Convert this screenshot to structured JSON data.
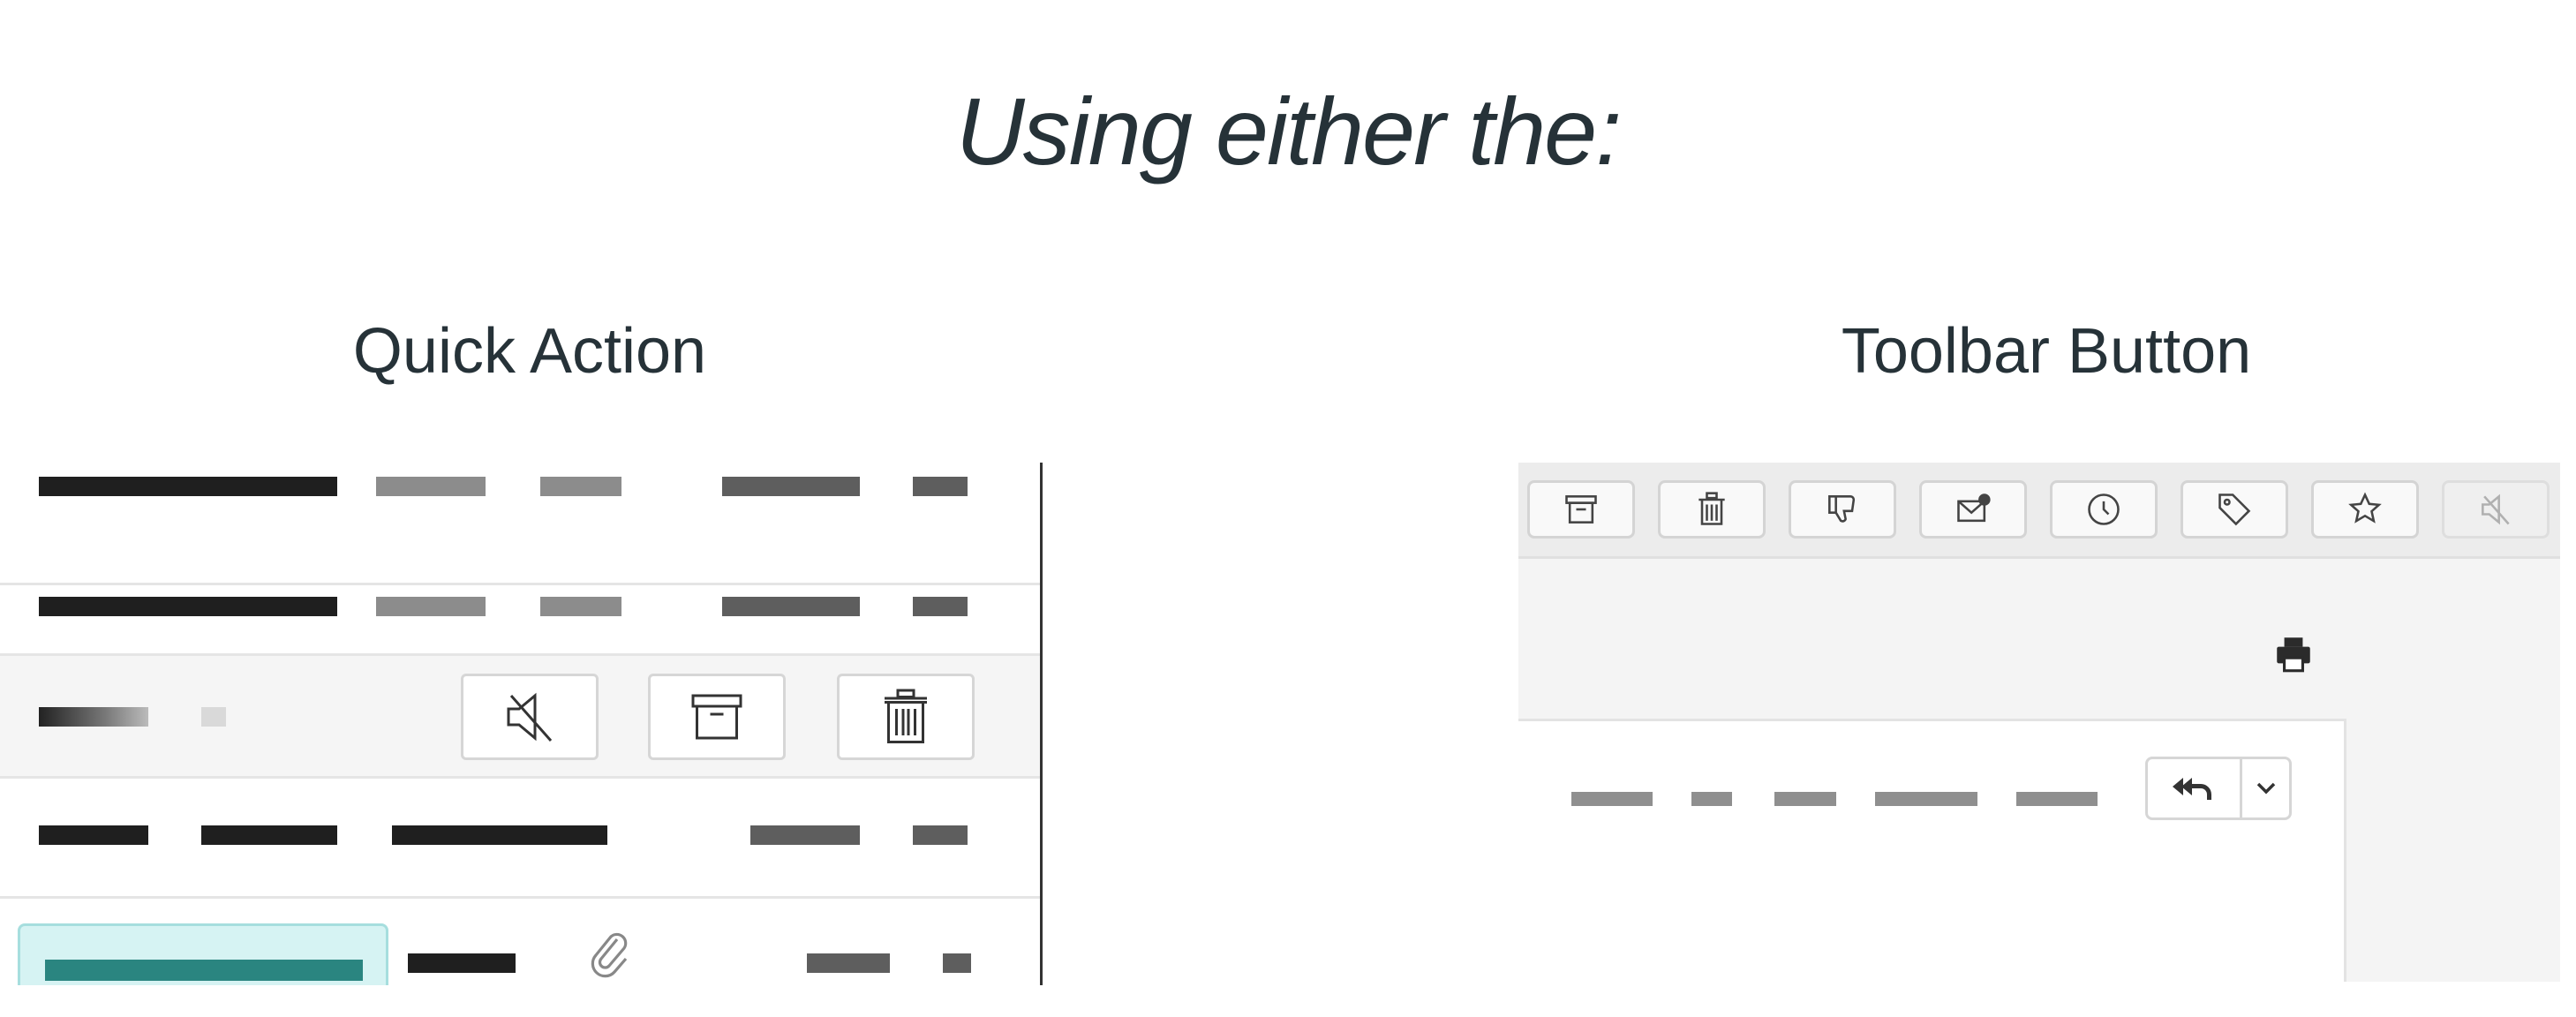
{
  "title": "Using either the:",
  "quick_action": {
    "label": "Quick Action",
    "buttons": [
      {
        "name": "mute",
        "icon": "mute-icon"
      },
      {
        "name": "archive",
        "icon": "archive-icon"
      },
      {
        "name": "delete",
        "icon": "trash-icon"
      }
    ]
  },
  "toolbar_button": {
    "label": "Toolbar Button",
    "toolbar_icons": [
      "archive-icon",
      "trash-icon",
      "thumbs-down-icon",
      "mark-unread-icon",
      "clock-icon",
      "tag-icon",
      "star-icon",
      "mute-icon"
    ],
    "reply_icon": "reply-all-icon",
    "print_icon": "printer-icon"
  },
  "colors": {
    "text": "#263238",
    "selected_chip": "#d6f3f3",
    "selected_bar": "#2a8580"
  }
}
